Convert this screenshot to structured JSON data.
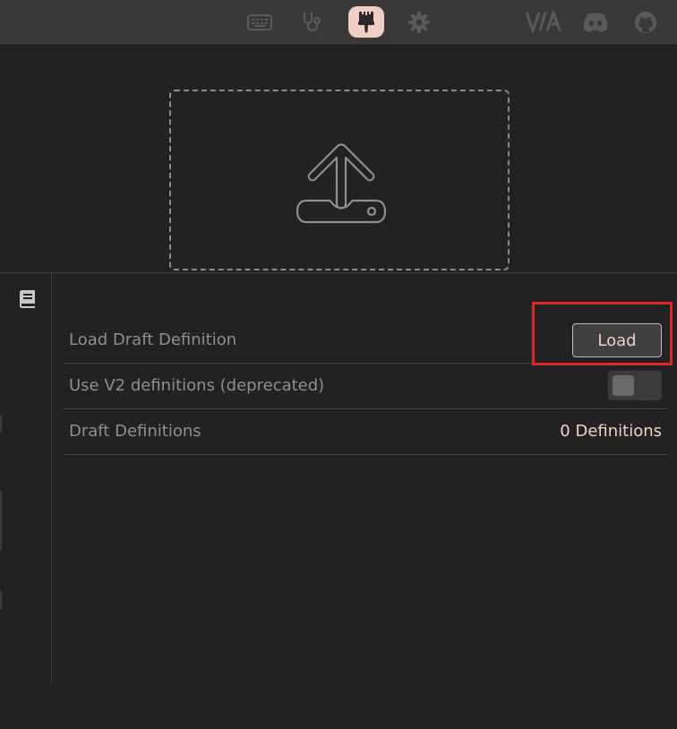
{
  "nav": {
    "items": [
      {
        "icon": "keyboard-icon",
        "active": false
      },
      {
        "icon": "stethoscope-icon",
        "active": false
      },
      {
        "icon": "paintbrush-icon",
        "active": true
      },
      {
        "icon": "gear-icon",
        "active": false
      }
    ],
    "links": [
      {
        "icon": "via-logo-icon"
      },
      {
        "icon": "discord-icon"
      },
      {
        "icon": "github-icon"
      }
    ]
  },
  "dropzone": {
    "icon": "upload-icon"
  },
  "settings": {
    "section_icon": "book-icon",
    "rows": [
      {
        "label": "Load Draft Definition",
        "button_label": "Load"
      },
      {
        "label": "Use V2 definitions (deprecated)",
        "toggle_on": false
      },
      {
        "label": "Draft Definitions",
        "value": "0 Definitions"
      }
    ]
  },
  "colors": {
    "accent": "#f1cec3",
    "background": "#222222",
    "topbar": "#393939",
    "highlight": "#e0242a"
  }
}
